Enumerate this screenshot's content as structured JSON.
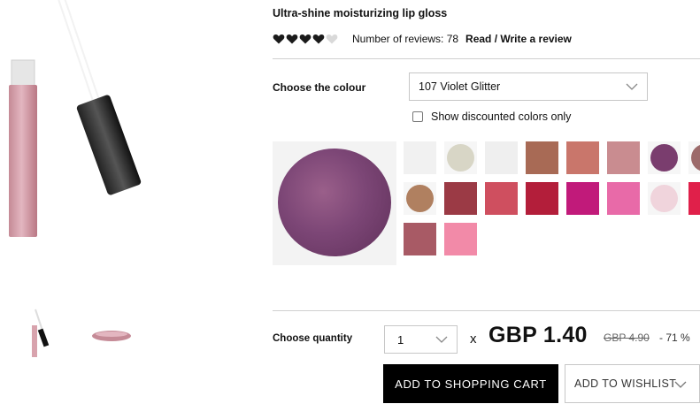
{
  "product": {
    "title": "Ultra-shine moisturizing lip gloss",
    "rating": 4,
    "rating_max": 5,
    "reviews_text": "Number of reviews: 78",
    "reviews_link": "Read / Write a review"
  },
  "colour": {
    "label": "Choose the colour",
    "selected": "107 Violet Glitter",
    "discount_toggle_label": "Show discounted colors only",
    "swatches": [
      "#f1f1f1",
      "#d8d6c6",
      "#efefef",
      "#a86a55",
      "#c9766b",
      "#c98c90",
      "#7a3d6e",
      "#9c6a6a",
      "#b08060",
      "#9b3a45",
      "#cf4f5f",
      "#b31e3a",
      "#c11a7a",
      "#e86aa8",
      "#f0d4dc",
      "#e0204a",
      "#a85a65",
      "#f28aa8"
    ]
  },
  "quantity": {
    "label": "Choose quantity",
    "value": "1"
  },
  "pricing": {
    "times": "x",
    "price": "GBP 1.40",
    "old_price": "GBP 4.90",
    "discount": "- 71 %"
  },
  "actions": {
    "cart_label": "ADD TO SHOPPING CART",
    "wishlist_label": "ADD TO WISHLIST"
  },
  "colors": {
    "border": "#c7c7c7",
    "cart_button": "#000000",
    "selected_shade": "#7c4676"
  }
}
